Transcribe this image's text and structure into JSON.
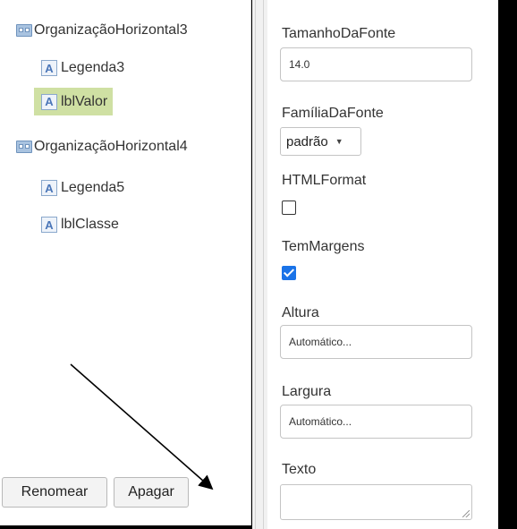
{
  "components_tree": {
    "items": [
      {
        "type": "arrangement",
        "label": "OrganizaçãoHorizontal3",
        "icon": "horizontal-arrangement-icon"
      },
      {
        "type": "label",
        "label": "Legenda3",
        "icon": "label-icon"
      },
      {
        "type": "label",
        "label": "lblValor",
        "icon": "label-icon",
        "selected": true
      },
      {
        "type": "arrangement",
        "label": "OrganizaçãoHorizontal4",
        "icon": "horizontal-arrangement-icon"
      },
      {
        "type": "label",
        "label": "Legenda5",
        "icon": "label-icon"
      },
      {
        "type": "label",
        "label": "lblClasse",
        "icon": "label-icon"
      }
    ],
    "label_icon_glyph": "A",
    "rename_button": "Renomear",
    "delete_button": "Apagar"
  },
  "properties": {
    "font_size_label": "TamanhoDaFonte",
    "font_size_value": "14.0",
    "font_family_label": "FamíliaDaFonte",
    "font_family_value": "padrão",
    "html_format_label": "HTMLFormat",
    "html_format_checked": false,
    "has_margins_label": "TemMargens",
    "has_margins_checked": true,
    "height_label": "Altura",
    "height_value": "Automático...",
    "width_label": "Largura",
    "width_value": "Automático...",
    "text_label": "Texto",
    "text_value": ""
  },
  "colors": {
    "selected_highlight": "#cfe0a3",
    "checkbox_checked": "#1a73e8",
    "background_outer": "#000000"
  }
}
